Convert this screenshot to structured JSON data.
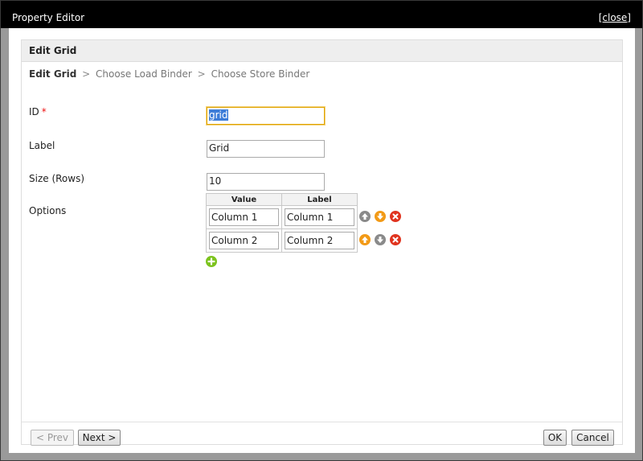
{
  "window": {
    "title": "Property Editor",
    "close_label": "[close]"
  },
  "panel": {
    "header": "Edit Grid"
  },
  "breadcrumb": {
    "step1": "Edit Grid",
    "sep": ">",
    "step2": "Choose Load Binder",
    "step3": "Choose Store Binder"
  },
  "form": {
    "id_label": "ID",
    "id_required": "*",
    "id_value": "grid",
    "label_label": "Label",
    "label_value": "Grid",
    "size_label": "Size (Rows)",
    "size_value": "10",
    "options_label": "Options",
    "options": {
      "headers": [
        "Value",
        "Label"
      ],
      "rows": [
        {
          "value": "Column 1",
          "label": "Column 1"
        },
        {
          "value": "Column 2",
          "label": "Column 2"
        }
      ]
    }
  },
  "buttons": {
    "prev": "< Prev",
    "next": "Next >",
    "ok": "OK",
    "cancel": "Cancel"
  },
  "colors": {
    "up_enabled": "#f29a17",
    "up_disabled": "#8a8a8a",
    "delete": "#e0341f",
    "add": "#7cc31e"
  },
  "icons": {
    "move_up": "arrow-up-icon",
    "move_down": "arrow-down-icon",
    "delete": "delete-icon",
    "add": "add-icon"
  }
}
